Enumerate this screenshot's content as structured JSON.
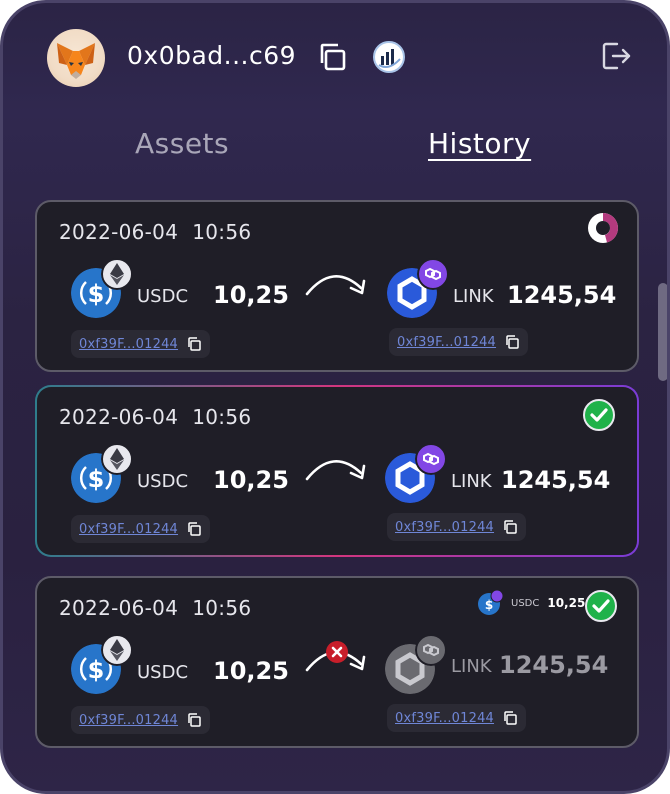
{
  "header": {
    "address": "0x0bad...c69",
    "avatar_icon": "metamask-fox-icon",
    "copy_icon": "copy-icon",
    "chart_icon": "chart-logo-icon",
    "logout_icon": "logout-icon"
  },
  "tabs": [
    {
      "label": "Assets",
      "active": false
    },
    {
      "label": "History",
      "active": true
    }
  ],
  "transactions": [
    {
      "date": "2022-06-04",
      "time": "10:56",
      "status": "pending",
      "from": {
        "symbol": "USDC",
        "amount": "10,25",
        "chain_badge": "ethereum-icon",
        "address": "0xf39F...01244"
      },
      "to": {
        "symbol": "LINK",
        "amount": "1245,54",
        "chain_badge": "polygon-icon",
        "address": "0xf39F...01244"
      }
    },
    {
      "date": "2022-06-04",
      "time": "10:56",
      "status": "success",
      "from": {
        "symbol": "USDC",
        "amount": "10,25",
        "chain_badge": "ethereum-icon",
        "address": "0xf39F...01244"
      },
      "to": {
        "symbol": "LINK",
        "amount": "1245,54",
        "chain_badge": "polygon-icon",
        "address": "0xf39F...01244"
      }
    },
    {
      "date": "2022-06-04",
      "time": "10:56",
      "status": "failed",
      "refund": {
        "symbol": "USDC",
        "amount": "10,25"
      },
      "from": {
        "symbol": "USDC",
        "amount": "10,25",
        "chain_badge": "ethereum-icon",
        "address": "0xf39F...01244"
      },
      "to": {
        "symbol": "LINK",
        "amount": "1245,54",
        "chain_badge": "polygon-icon",
        "address": "0xf39F...01244"
      }
    }
  ],
  "colors": {
    "background": "#2b2342",
    "card": "#1f1e27",
    "usdc": "#2775ca",
    "chainlink": "#2a5ada",
    "polygon": "#8247e5",
    "success": "#1fb24a",
    "error": "#c81e2a",
    "pending": "#b33a7e",
    "link": "#6f86d6"
  }
}
